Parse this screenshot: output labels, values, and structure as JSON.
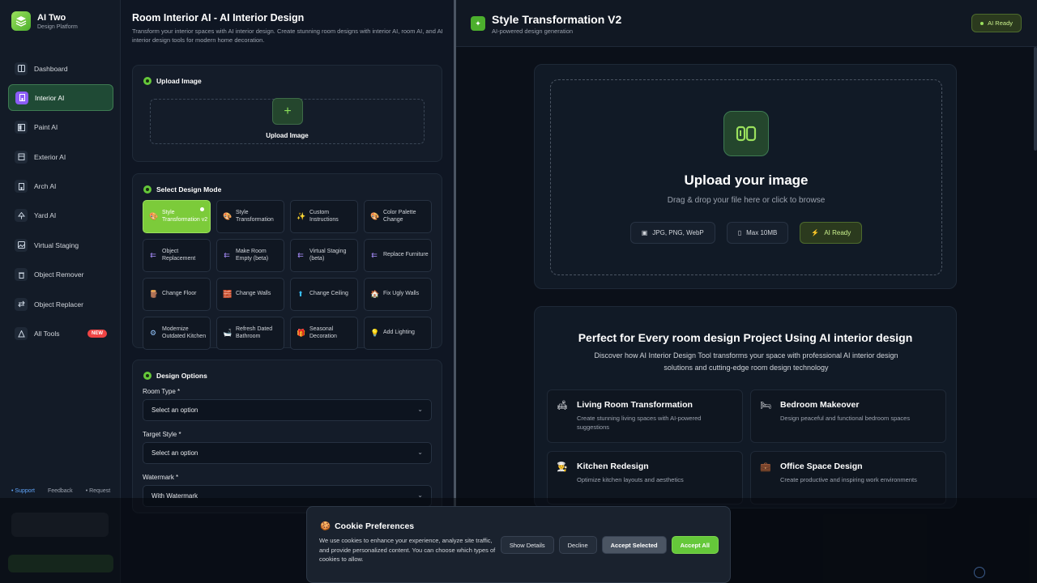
{
  "brand": {
    "name": "AI Two",
    "subtitle": "Design Platform"
  },
  "sidebar": {
    "items": [
      {
        "label": "Dashboard",
        "icon": "dashboard-icon"
      },
      {
        "label": "Interior AI",
        "icon": "building-icon",
        "active": true
      },
      {
        "label": "Paint AI",
        "icon": "paint-icon"
      },
      {
        "label": "Exterior AI",
        "icon": "house-icon"
      },
      {
        "label": "Arch AI",
        "icon": "arch-icon"
      },
      {
        "label": "Yard AI",
        "icon": "tree-icon"
      },
      {
        "label": "Virtual Staging",
        "icon": "image-icon"
      },
      {
        "label": "Object Remover",
        "icon": "trash-icon"
      },
      {
        "label": "Object Replacer",
        "icon": "swap-icon"
      },
      {
        "label": "All Tools",
        "icon": "tools-icon",
        "badge": "NEW"
      }
    ],
    "footer": [
      "Support",
      "Feedback",
      "Request"
    ]
  },
  "left": {
    "title": "Room Interior AI - AI Interior Design",
    "description": "Transform your interior spaces with AI interior design. Create stunning room designs with interior AI, room AI, and AI interior design tools for modern home decoration.",
    "upload": {
      "heading": "Upload Image",
      "label": "Upload Image",
      "plus": "+"
    },
    "mode": {
      "heading": "Select Design Mode",
      "modes": [
        {
          "label": "Style Transformation v2",
          "icon": "🎨",
          "selected": true
        },
        {
          "label": "Style Transformation",
          "icon": "🎨"
        },
        {
          "label": "Custom Instructions",
          "icon": "✨"
        },
        {
          "label": "Color Palette Change",
          "icon": "🎨"
        },
        {
          "label": "Object Replacement",
          "icon": "⇇"
        },
        {
          "label": "Make Room Empty (beta)",
          "icon": "⇇"
        },
        {
          "label": "Virtual Staging (beta)",
          "icon": "⇇"
        },
        {
          "label": "Replace Furniture",
          "icon": "⇇"
        },
        {
          "label": "Change Floor",
          "icon": "🪵"
        },
        {
          "label": "Change Walls",
          "icon": "🧱"
        },
        {
          "label": "Change Ceiling",
          "icon": "⬆"
        },
        {
          "label": "Fix Ugly Walls",
          "icon": "🏠"
        },
        {
          "label": "Modernize Outdated Kitchen",
          "icon": "⚙"
        },
        {
          "label": "Refresh Dated Bathroom",
          "icon": "🛁"
        },
        {
          "label": "Seasonal Decoration",
          "icon": "🎁"
        },
        {
          "label": "Add Lighting",
          "icon": "💡"
        }
      ]
    },
    "options": {
      "heading": "Design Options",
      "room_type_label": "Room Type *",
      "room_type_value": "Select an option",
      "target_style_label": "Target Style *",
      "target_style_value": "Select an option",
      "watermark_label": "Watermark *",
      "watermark_value": "With Watermark"
    }
  },
  "main": {
    "title": "Style Transformation V2",
    "subtitle": "AI-powered design generation",
    "status": "AI Ready",
    "upload": {
      "title": "Upload your image",
      "subtitle": "Drag & drop your file here or click to browse",
      "chips": [
        "JPG, PNG, WebP",
        "Max 10MB",
        "AI Ready"
      ]
    },
    "info": {
      "title": "Perfect for Every room design Project Using AI interior design",
      "description": "Discover how AI Interior Design Tool transforms your space with professional AI interior design solutions and cutting-edge room design technology",
      "features": [
        {
          "title": "Living Room Transformation",
          "desc": "Create stunning living spaces with AI-powered suggestions",
          "icon": "🛋"
        },
        {
          "title": "Bedroom Makeover",
          "desc": "Design peaceful and functional bedroom spaces",
          "icon": "🛏"
        },
        {
          "title": "Kitchen Redesign",
          "desc": "Optimize kitchen layouts and aesthetics",
          "icon": "👨‍🍳"
        },
        {
          "title": "Office Space Design",
          "desc": "Create productive and inspiring work environments",
          "icon": "💼"
        }
      ]
    }
  },
  "cookie": {
    "title": "Cookie Preferences",
    "icon": "🍪",
    "text": "We use cookies to enhance your experience, analyze site traffic, and provide personalized content. You can choose which types of cookies to allow.",
    "buttons": {
      "details": "Show Details",
      "decline": "Decline",
      "selected": "Accept Selected",
      "all": "Accept All"
    }
  },
  "colors": {
    "accent": "#65c83a",
    "active_nav": "#1f4a35",
    "background": "#0f1623"
  }
}
